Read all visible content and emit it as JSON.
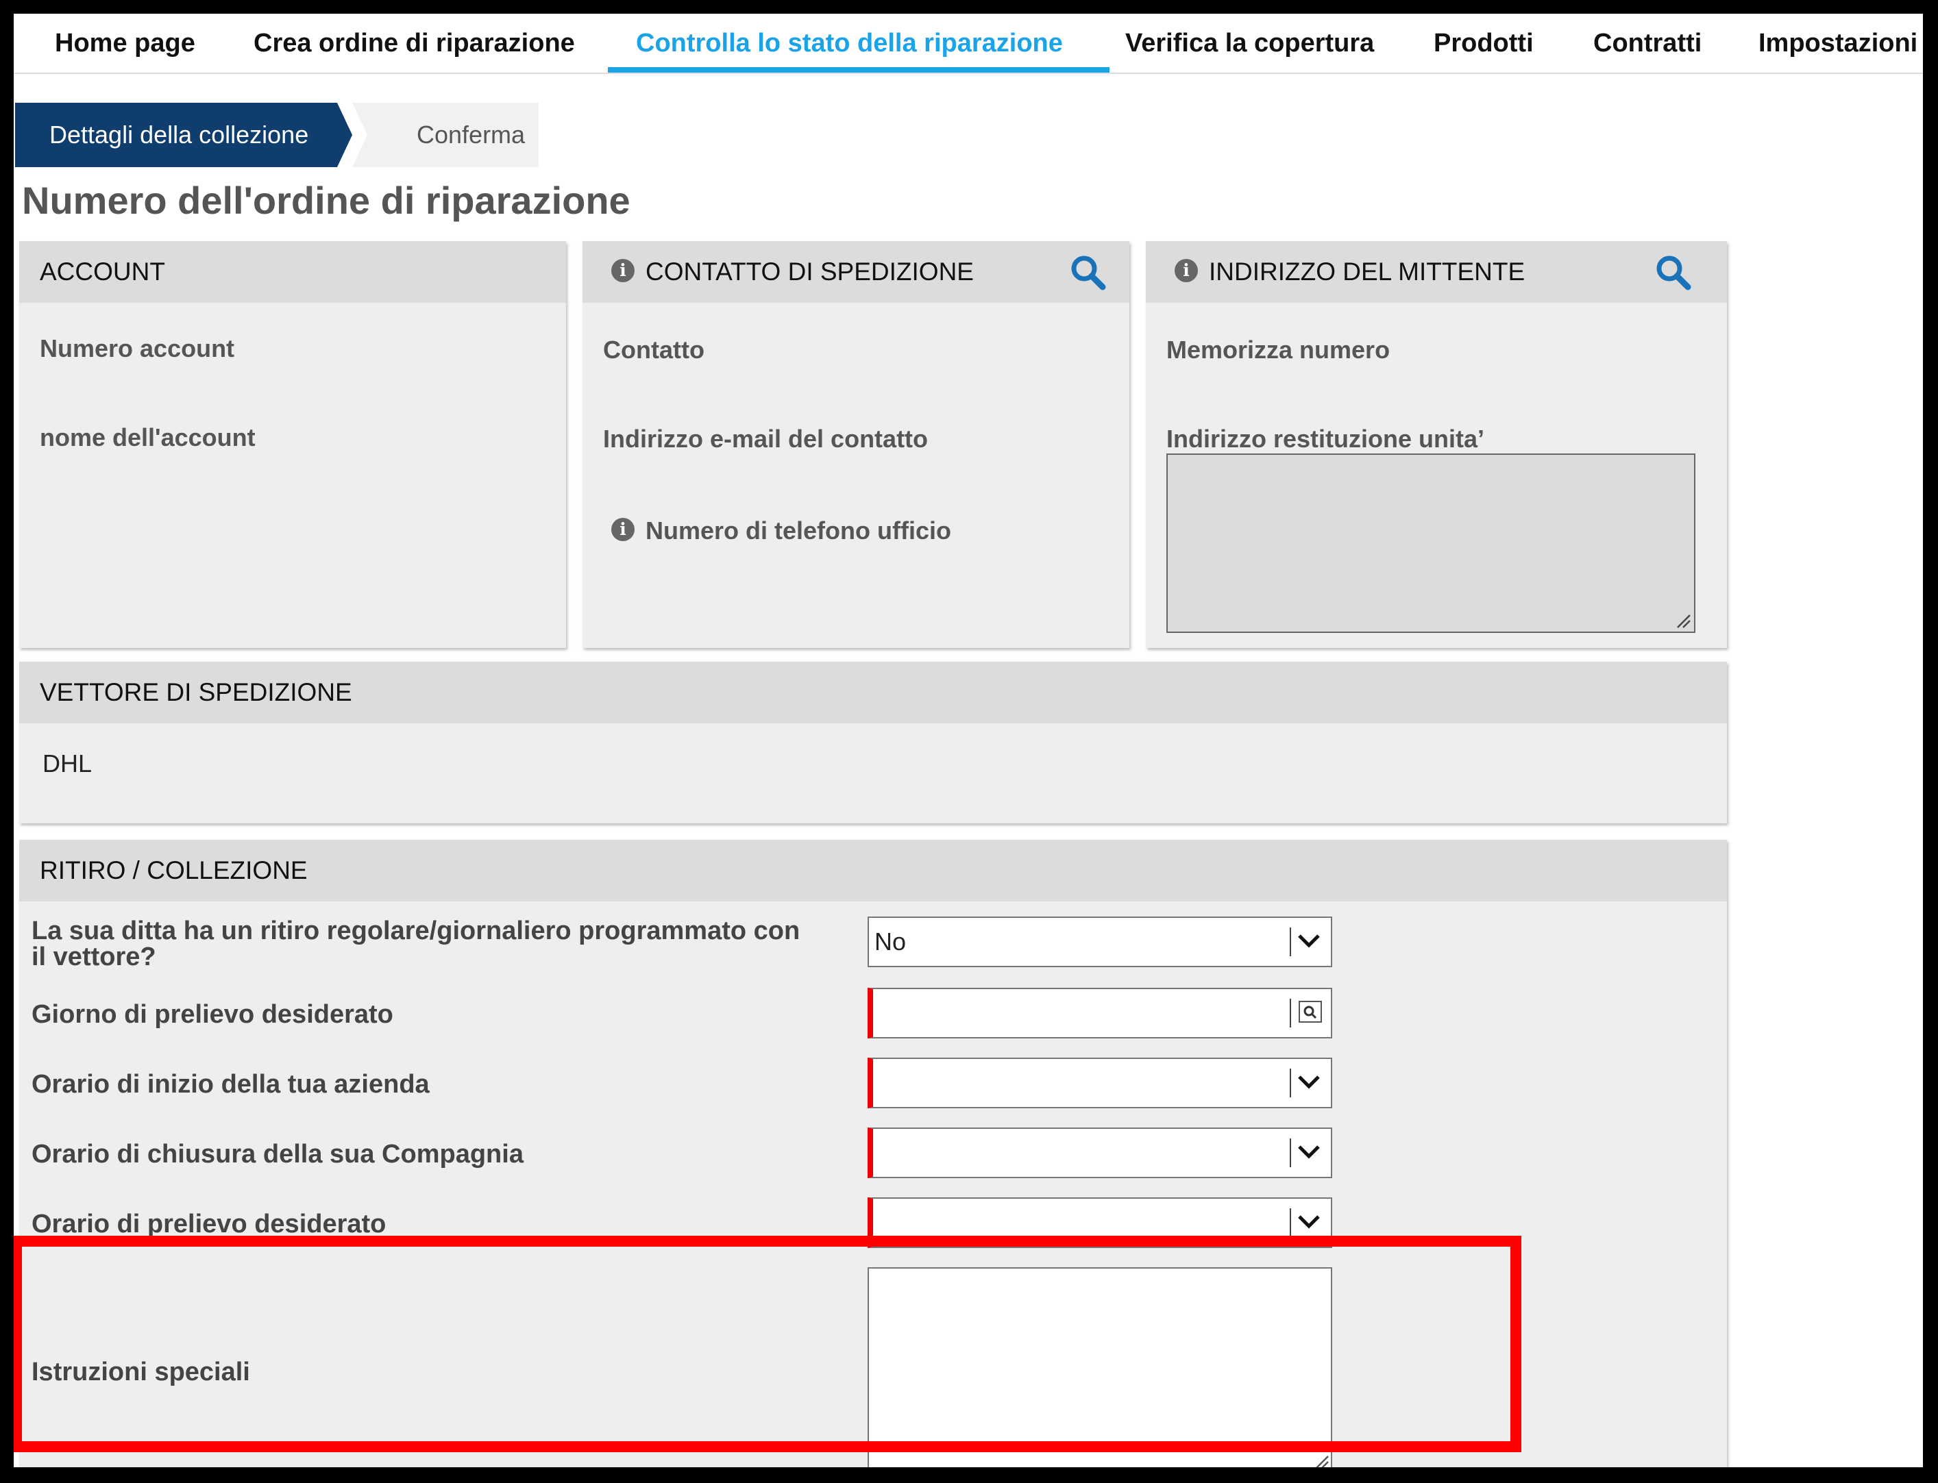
{
  "nav": {
    "items": [
      {
        "label": "Home page"
      },
      {
        "label": "Crea ordine di riparazione"
      },
      {
        "label": "Controlla lo stato della riparazione"
      },
      {
        "label": "Verifica la copertura"
      },
      {
        "label": "Prodotti"
      },
      {
        "label": "Contratti"
      },
      {
        "label": "Impostazioni"
      }
    ],
    "active_index": 2,
    "active_color": "#1aa3e8"
  },
  "wizard": {
    "steps": [
      {
        "label": "Dettagli della collezione",
        "state": "current"
      },
      {
        "label": "Conferma",
        "state": "pending"
      }
    ],
    "active_color": "#0e3d6e"
  },
  "page_title": "Numero dell'ordine di riparazione",
  "account": {
    "title": "ACCOUNT",
    "fields": [
      "Numero account",
      "nome dell'account"
    ]
  },
  "shipping_contact": {
    "title": "CONTATTO DI SPEDIZIONE",
    "fields": [
      "Contatto",
      "Indirizzo e-mail del contatto",
      "Numero di telefono ufficio"
    ]
  },
  "sender_address": {
    "title": "INDIRIZZO DEL MITTENTE",
    "fields": [
      "Memorizza numero",
      "Indirizzo restituzione unita’"
    ]
  },
  "carrier": {
    "title": "VETTORE DI SPEDIZIONE",
    "value": "DHL"
  },
  "pickup": {
    "title": "RITIRO / COLLEZIONE",
    "regular_pickup": {
      "label": "La sua ditta ha un ritiro regolare/giornaliero programmato con il vettore?",
      "value": "No"
    },
    "pickup_day": {
      "label": "Giorno di prelievo desiderato",
      "value": ""
    },
    "open_time": {
      "label": "Orario di inizio della tua azienda",
      "value": ""
    },
    "close_time": {
      "label": "Orario di chiusura della sua Compagnia",
      "value": ""
    },
    "pickup_time": {
      "label": "Orario di prelievo desiderato",
      "value": ""
    },
    "special_instructions": {
      "label": "Istruzioni speciali",
      "value": ""
    }
  },
  "colors": {
    "required_marker": "#e00000",
    "highlight": "#ff0000",
    "panel_bg": "#eeeeee",
    "panel_header_bg": "#dcdcdc"
  }
}
